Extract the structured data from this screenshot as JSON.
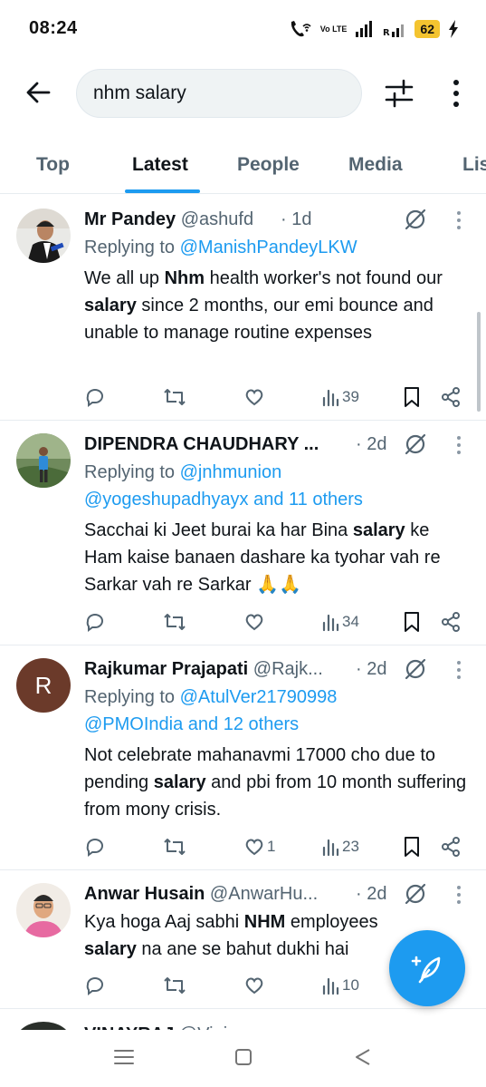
{
  "status_bar": {
    "time": "08:24",
    "network_label": "Vo LTE",
    "battery": "62",
    "icons": [
      "wifi-call-icon",
      "signal-icon",
      "battery-icon",
      "charging-icon"
    ]
  },
  "search": {
    "query": "nhm salary"
  },
  "tabs": [
    {
      "label": "Top"
    },
    {
      "label": "Latest"
    },
    {
      "label": "People"
    },
    {
      "label": "Media"
    },
    {
      "label": "Lis"
    }
  ],
  "tweets": [
    {
      "name": "Mr Pandey",
      "handle": "@ashufd",
      "time": "· 1d",
      "replying_prefix": "Replying to ",
      "replying_line1": "@ManishPandeyLKW",
      "replying_line2": "",
      "body": [
        {
          "t": "We all up ",
          "b": false
        },
        {
          "t": "Nhm",
          "b": true
        },
        {
          "t": " health worker's not found our ",
          "b": false
        },
        {
          "t": "salary",
          "b": true
        },
        {
          "t": " since 2 months, our emi bounce and unable to manage routine expenses",
          "b": false
        }
      ],
      "likes": "",
      "views": "39"
    },
    {
      "name": "DIPENDRA CHAUDHARY ...",
      "handle": "",
      "time": "· 2d",
      "replying_prefix": "Replying to ",
      "replying_line1": "@jnhmunion",
      "replying_line2": "@yogeshupadhyayx and 11 others",
      "body": [
        {
          "t": "Sacchai ki Jeet burai ka har Bina ",
          "b": false
        },
        {
          "t": "salary",
          "b": true
        },
        {
          "t": " ke Ham kaise banaen dashare ka tyohar vah re Sarkar vah re Sarkar 🙏🙏",
          "b": false
        }
      ],
      "likes": "",
      "views": "34"
    },
    {
      "name": "Rajkumar Prajapati",
      "handle": "@Rajk...",
      "time": "· 2d",
      "avatar_letter": "R",
      "replying_prefix": "Replying to ",
      "replying_line1": "@AtulVer21790998",
      "replying_line2": "@PMOIndia and 12 others",
      "body": [
        {
          "t": "Not celebrate mahanavmi 17000 cho due to pending ",
          "b": false
        },
        {
          "t": "salary",
          "b": true
        },
        {
          "t": " and pbi from 10 month suffering from mony crisis.",
          "b": false
        }
      ],
      "likes": "1",
      "views": "23"
    },
    {
      "name": "Anwar Husain",
      "handle": "@AnwarHu...",
      "time": "· 2d",
      "replying_prefix": "",
      "replying_line1": "",
      "replying_line2": "",
      "body": [
        {
          "t": "Kya hoga Aaj sabhi ",
          "b": false
        },
        {
          "t": "NHM",
          "b": true
        },
        {
          "t": " employees ",
          "b": false
        },
        {
          "t": "salary",
          "b": true
        },
        {
          "t": " na ane se bahut dukhi hai",
          "b": false
        }
      ],
      "likes": "",
      "views": "10"
    }
  ],
  "partial_next": {
    "name": "VINAYRAJ",
    "handle": "@Vini..."
  },
  "colors": {
    "accent": "#1d9bf0",
    "text": "#0f1419",
    "muted": "#536471",
    "divider": "#e7ecf0"
  }
}
